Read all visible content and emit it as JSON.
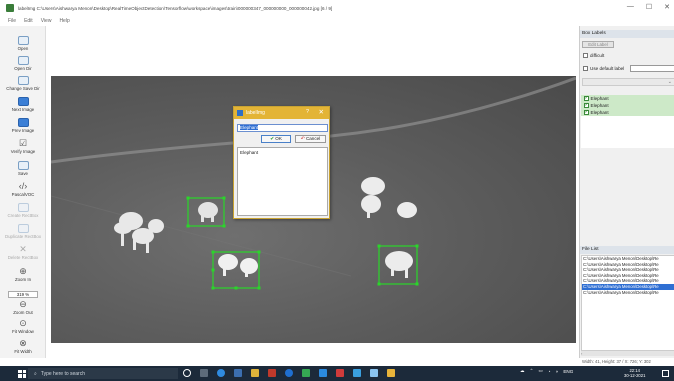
{
  "window": {
    "title": "labelImg C:\\Users\\Aishwarya Menon\\Desktop\\RealTimeObjectDetection\\Tensorflow\\workspace\\images\\train\\000000347_000000000_000000042.jpg [6 / 9]",
    "min": "—",
    "max": "☐",
    "close": "✕"
  },
  "menu": [
    "File",
    "Edit",
    "View",
    "Help"
  ],
  "toolbar": {
    "open": "Open",
    "open_dir": "Open Dir",
    "change_save_dir": "Change Save Dir",
    "next_image": "Next Image",
    "prev_image": "Prev Image",
    "verify_image": "Verify Image",
    "save": "Save",
    "format": "PascalVOC",
    "create_rectbox": "Create RectBox",
    "duplicate_rectbox": "Duplicate RectBox",
    "delete_rectbox": "Delete RectBox",
    "zoom_in": "Zoom In",
    "zoom_value": "319 %",
    "zoom_out": "Zoom Out",
    "fit_window": "Fit Window",
    "fit_width": "Fit Width"
  },
  "dialog": {
    "title": "labelImg",
    "help": "?",
    "close": "✕",
    "input_value": "Elephant",
    "ok": "OK",
    "cancel": "Cancel",
    "list": [
      "Elephant"
    ]
  },
  "right_panel": {
    "box_labels_title": "Box Labels",
    "edit_label": "Edit Label",
    "difficult": "difficult",
    "use_default_label": "Use default label",
    "labels": [
      "Elephant",
      "Elephant",
      "Elephant"
    ],
    "file_list_title": "File List",
    "files": [
      "C:\\Users\\Aishwarya Menon\\Desktop\\Re",
      "C:\\Users\\Aishwarya Menon\\Desktop\\Re",
      "C:\\Users\\Aishwarya Menon\\Desktop\\Re",
      "C:\\Users\\Aishwarya Menon\\Desktop\\Re",
      "C:\\Users\\Aishwarya Menon\\Desktop\\Re",
      "C:\\Users\\Aishwarya Menon\\Desktop\\Re",
      "C:\\Users\\Aishwarya Menon\\Desktop\\Re"
    ],
    "selected_file_index": 5
  },
  "status": {
    "text": "Width: 41, Height: 37 / X: 726; Y: 302"
  },
  "taskbar": {
    "search_placeholder": "Type here to search",
    "lang": "ENG",
    "time": "22:14",
    "date": "30-12-2021"
  },
  "colors": {
    "dialog_title": "#e3b436",
    "bbox": "#2ad62a",
    "selected": "#2f6fd3",
    "label_bg": "#cde9c8"
  }
}
